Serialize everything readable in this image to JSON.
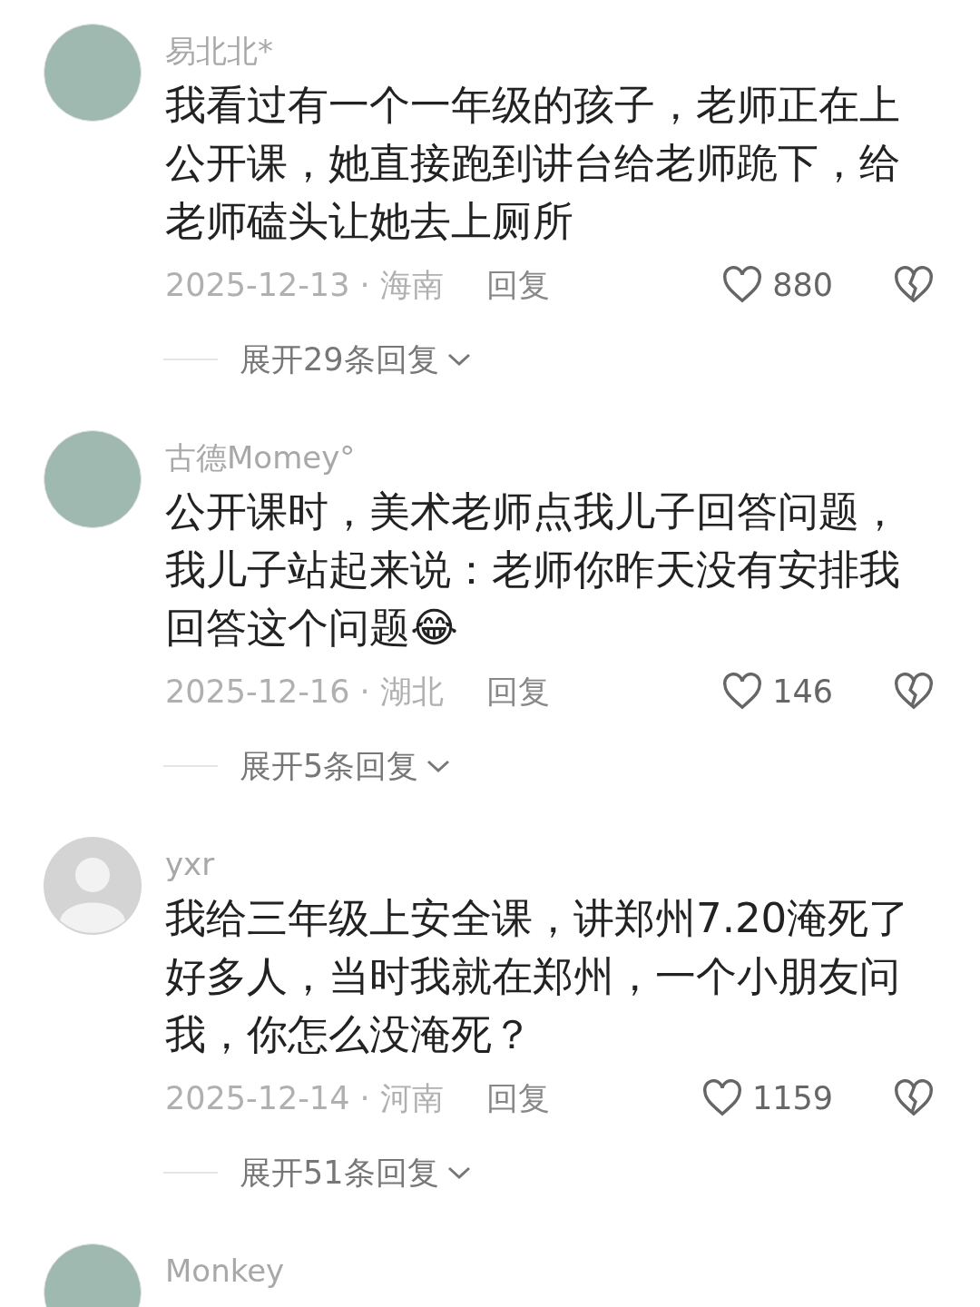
{
  "comments": [
    {
      "avatar": {
        "kind": "photo"
      },
      "name": "易北北*",
      "text": "我看过有一个一年级的孩子，老师正在上公开课，她直接跑到讲台给老师跪下，给老师磕头让她去上厕所",
      "meta": "2025-12-13 · 海南",
      "reply": "回复",
      "likes": "880",
      "expand": "展开29条回复"
    },
    {
      "avatar": {
        "kind": "photo"
      },
      "name": "古德Momey°",
      "text": "公开课时，美术老师点我儿子回答问题，我儿子站起来说：老师你昨天没有安排我回答这个问题😂",
      "meta": "2025-12-16 · 湖北",
      "reply": "回复",
      "likes": "146",
      "expand": "展开5条回复"
    },
    {
      "avatar": {
        "kind": "default"
      },
      "name": "yxr",
      "text": "我给三年级上安全课，讲郑州7.20淹死了好多人，当时我就在郑州，一个小朋友问我，你怎么没淹死？",
      "meta": "2025-12-14 · 河南",
      "reply": "回复",
      "likes": "1159",
      "expand": "展开51条回复"
    },
    {
      "avatar": {
        "kind": "photo"
      },
      "name": "Monkey"
    }
  ]
}
